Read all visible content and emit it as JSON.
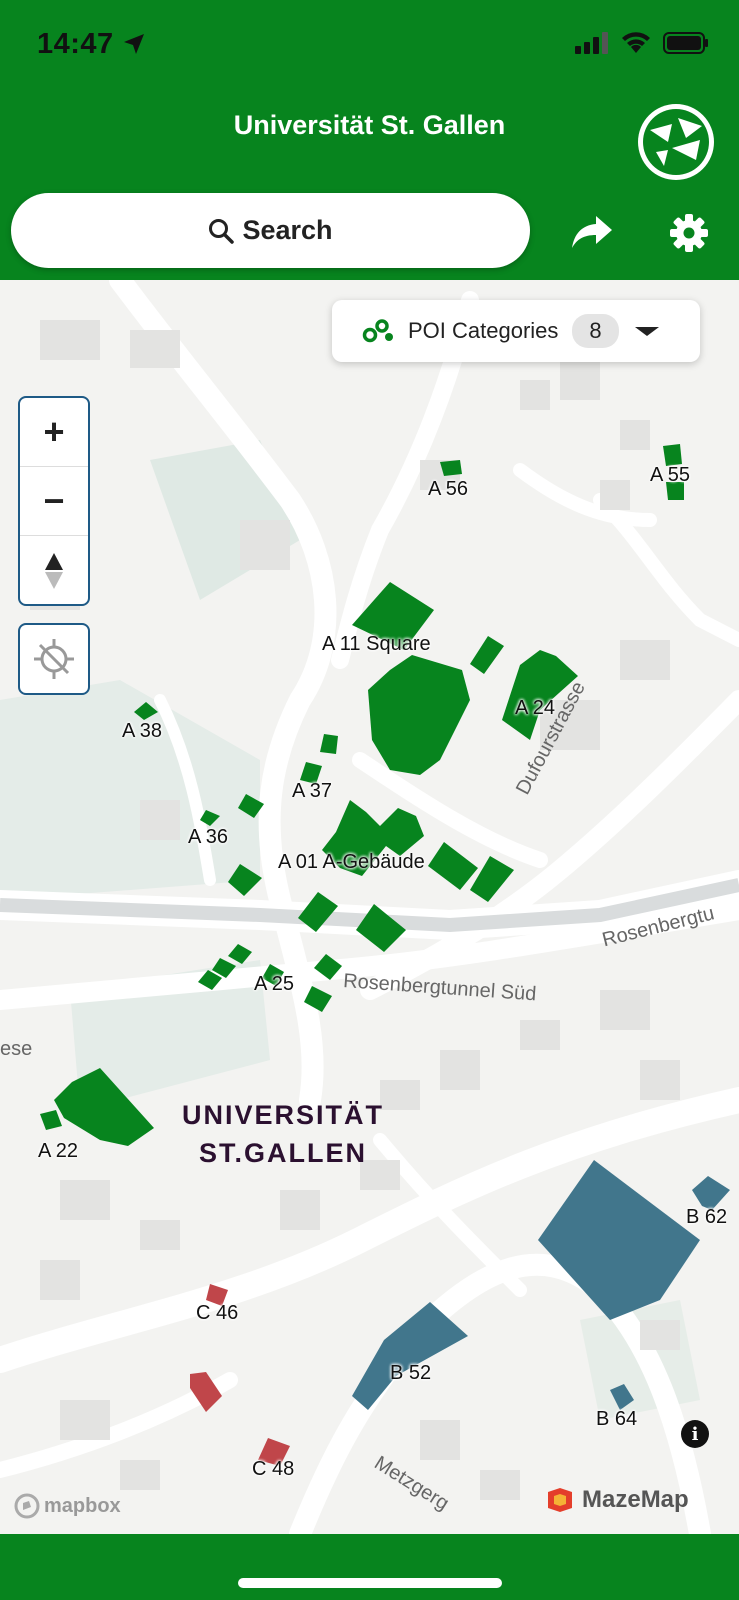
{
  "status_bar": {
    "time": "14:47"
  },
  "header": {
    "title": "Universität St. Gallen",
    "logo_icon": "university-logo"
  },
  "search": {
    "label": "Search",
    "icon": "search-icon"
  },
  "actions": {
    "share_icon": "share-icon",
    "settings_icon": "gear-icon"
  },
  "poi": {
    "label": "POI Categories",
    "count": "8"
  },
  "controls": {
    "zoom_in": "+",
    "zoom_out": "−"
  },
  "map": {
    "buildings": [
      "A 56",
      "A 55",
      "A 11 Square",
      "A 24",
      "A 38",
      "A 37",
      "A 36",
      "A 01 A-Gebäude",
      "A 25",
      "A 22",
      "B 62",
      "C 46",
      "B 52",
      "B 64",
      "C 48"
    ],
    "roads": [
      "Dufourstrasse",
      "Rosenbergtunnel Süd",
      "Rosenbergtu",
      "Metzgerg",
      "ese"
    ],
    "campus_label_line1": "UNIVERSITÄT",
    "campus_label_line2": "ST.GALLEN"
  },
  "attribution": {
    "mapbox": "mapbox",
    "mazemap": "MazeMap"
  },
  "colors": {
    "header": "#07841e",
    "building_green": "#07841e",
    "building_blue": "#41768c",
    "building_red": "#c0464a"
  }
}
